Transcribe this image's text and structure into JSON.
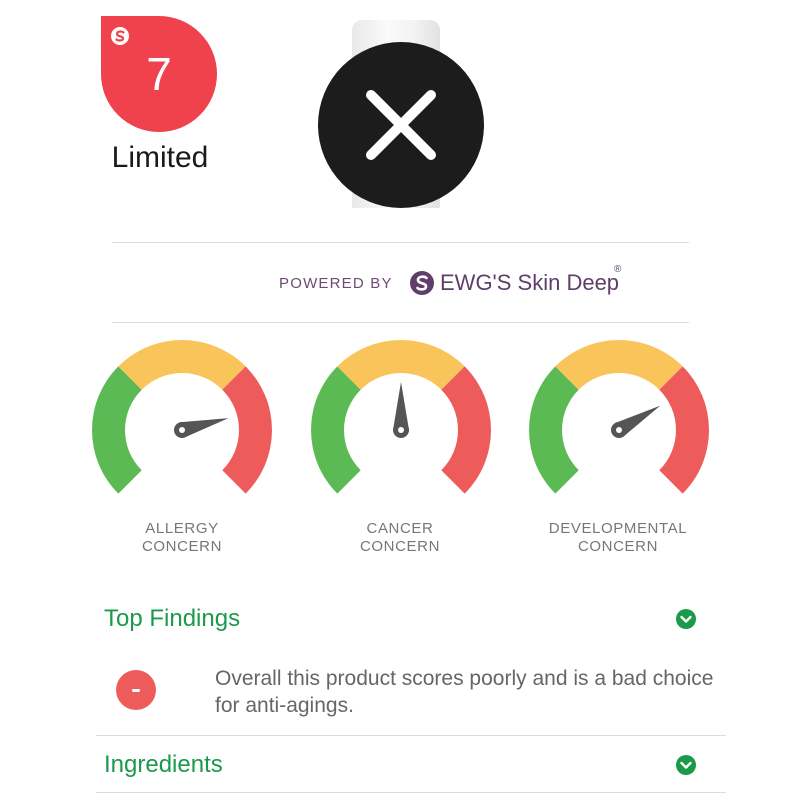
{
  "score": {
    "value": "7",
    "rating": "Limited",
    "badge_color": "#f0424c",
    "logo_icon": "skin-deep-logo-icon"
  },
  "product": {
    "close_icon": "close-icon"
  },
  "powered_by": {
    "prefix": "POWERED BY",
    "brand": "EWG'S Skin Deep",
    "registered": "®",
    "brand_color": "#5f3f6a"
  },
  "gauges": [
    {
      "line1": "ALLERGY",
      "line2": "CONCERN",
      "level": 0.78
    },
    {
      "line1": "CANCER",
      "line2": "CONCERN",
      "level": 0.5
    },
    {
      "line1": "DEVELOPMENTAL",
      "line2": "CONCERN",
      "level": 0.72
    }
  ],
  "gauge_colors": {
    "low": "#5cba54",
    "moderate": "#f9c55a",
    "high": "#ee5b5b",
    "needle": "#555555"
  },
  "top_findings": {
    "title": "Top Findings",
    "items": [
      {
        "text": "Overall this product scores poorly and is a bad choice for anti-agings.",
        "icon": "minus-icon"
      }
    ]
  },
  "ingredients": {
    "title": "Ingredients"
  },
  "accent_green": "#1c9a4b"
}
